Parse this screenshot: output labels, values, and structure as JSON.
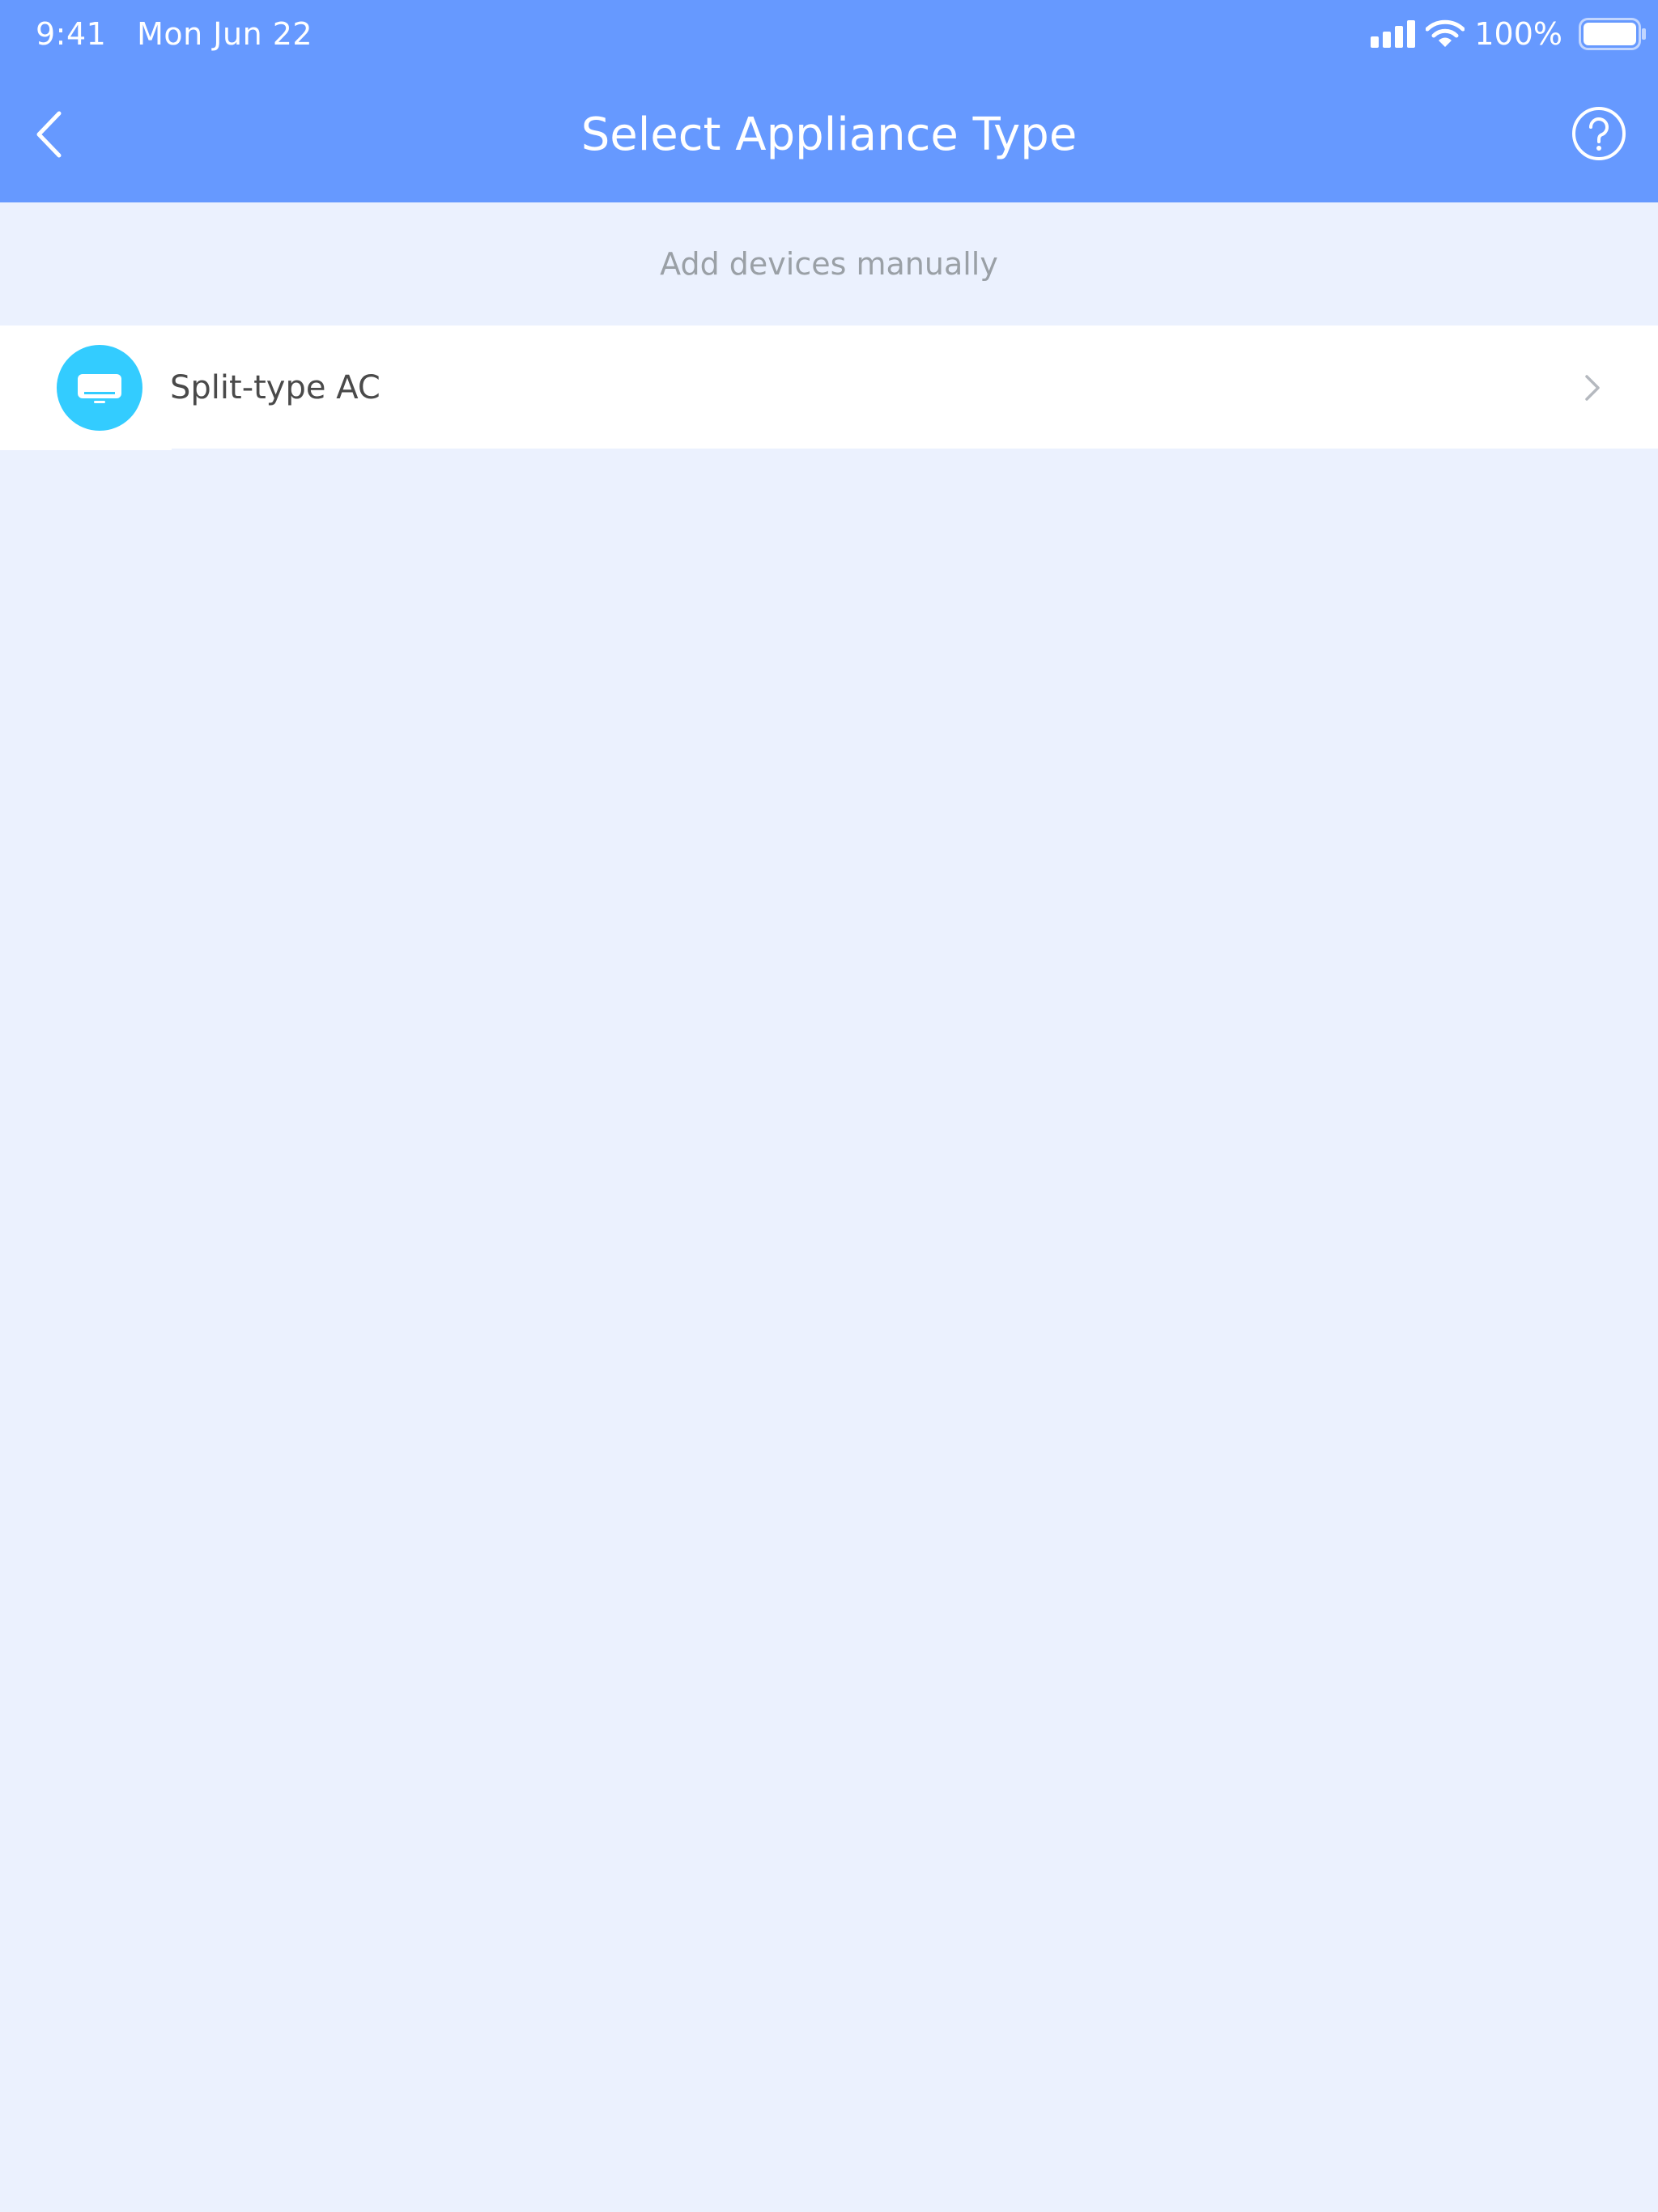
{
  "status_bar": {
    "time": "9:41",
    "date": "Mon Jun 22",
    "battery_percent": "100%",
    "battery_level": 1.0,
    "icons": [
      "signal-icon",
      "wifi-icon",
      "battery-icon"
    ]
  },
  "header": {
    "title": "Select Appliance Type",
    "back_icon": "chevron-left-icon",
    "help_icon": "question-circle-icon"
  },
  "section": {
    "caption": "Add devices manually"
  },
  "appliances": [
    {
      "label": "Split-type AC",
      "icon": "air-conditioner-icon",
      "trailing_icon": "chevron-right-icon"
    }
  ],
  "colors": {
    "header_bg": "#6699ff",
    "page_bg": "#ebf1fe",
    "icon_circle": "#33ccff",
    "caption_text": "#9aa0a6",
    "item_text": "#4a4a4a",
    "chevron": "#b5b9bf"
  }
}
